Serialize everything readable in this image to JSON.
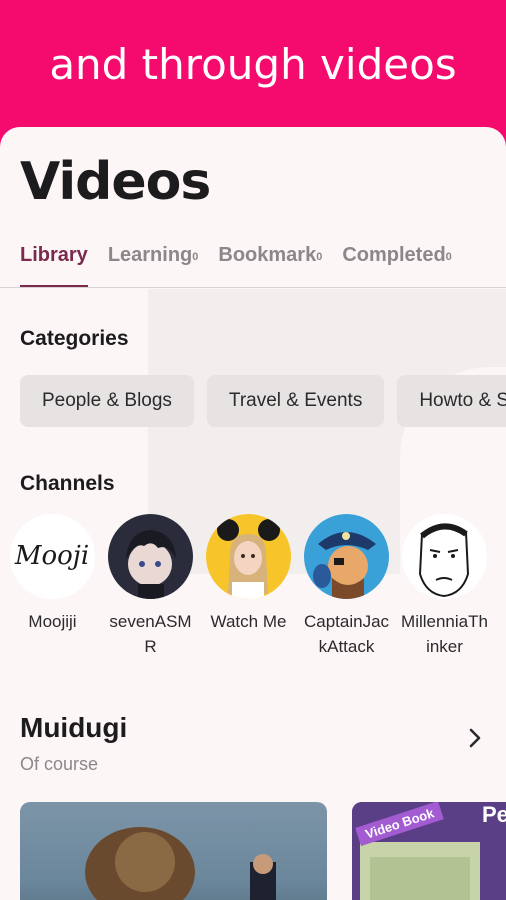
{
  "banner": {
    "title": "and through videos",
    "color": "#f50a6e"
  },
  "page": {
    "title": "Videos"
  },
  "tabs": [
    {
      "label": "Library",
      "count": "",
      "active": true
    },
    {
      "label": "Learning",
      "count": "0",
      "active": false
    },
    {
      "label": "Bookmark",
      "count": "0",
      "active": false
    },
    {
      "label": "Completed",
      "count": "0",
      "active": false
    }
  ],
  "categories": {
    "heading": "Categories",
    "items": [
      "People & Blogs",
      "Travel & Events",
      "Howto & Style"
    ]
  },
  "channels": {
    "heading": "Channels",
    "items": [
      {
        "name": "Moojiji",
        "avatar_icon": "moojiji-logo-avatar"
      },
      {
        "name": "sevenASMR",
        "avatar_icon": "anime-boy-avatar"
      },
      {
        "name": "Watch Me",
        "avatar_icon": "girl-with-ears-avatar"
      },
      {
        "name": "CaptainJackAttack",
        "avatar_icon": "pirate-cartoon-avatar"
      },
      {
        "name": "MillenniaThinker",
        "avatar_icon": "wojak-face-avatar"
      }
    ]
  },
  "section": {
    "title": "Muidugi",
    "subtitle": "Of course"
  },
  "thumbs": {
    "second_label": "Video Book",
    "second_partial": "Pe"
  },
  "colors": {
    "accent": "#7a2a4d",
    "sheet": "#fcf6f6",
    "chip": "#e8e3e3"
  }
}
